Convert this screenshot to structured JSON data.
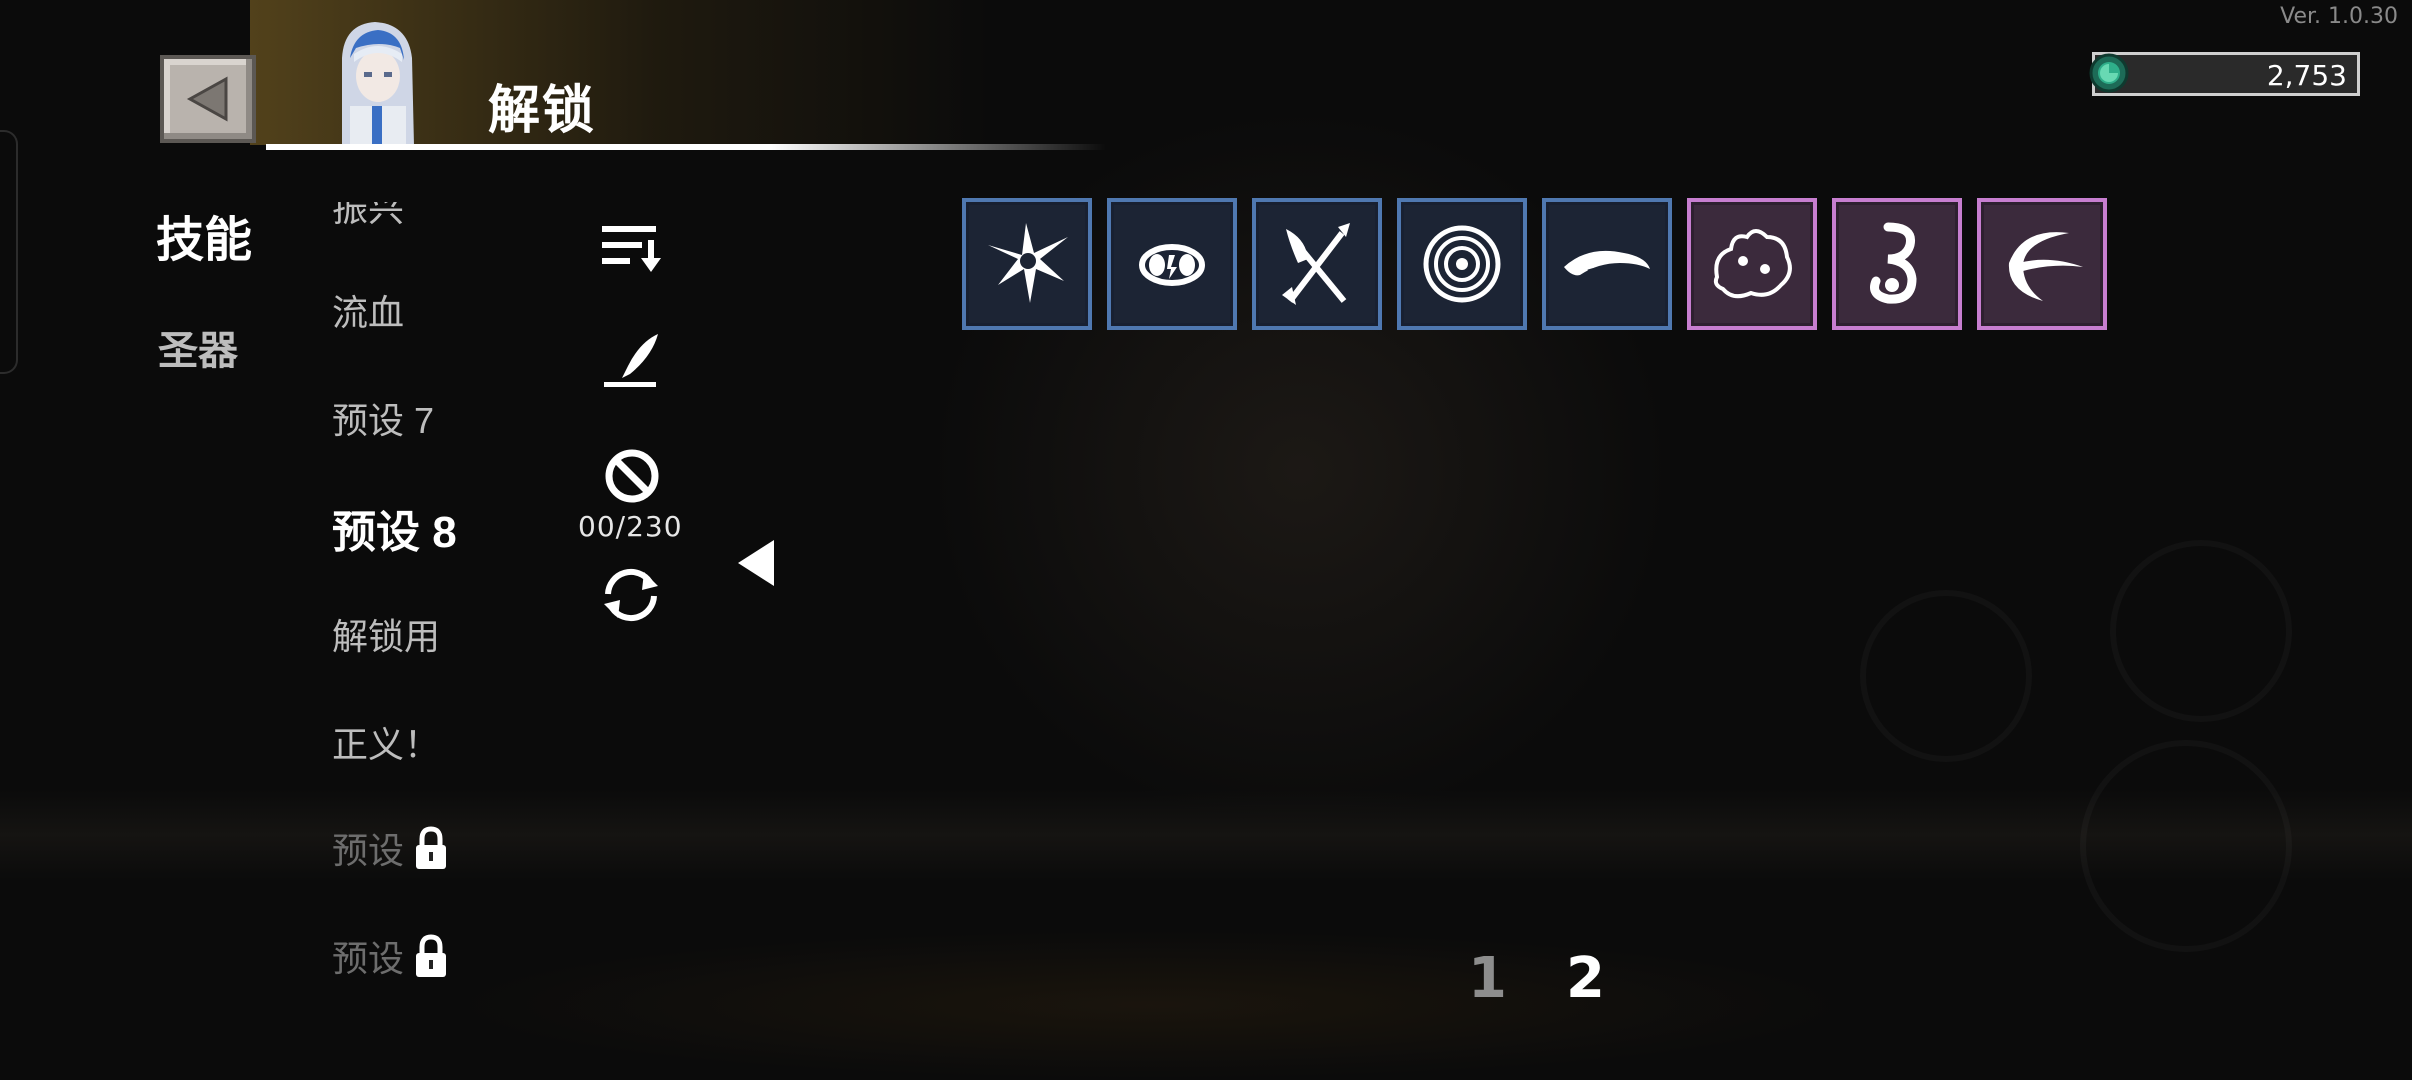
{
  "version": "Ver. 1.0.30",
  "header": {
    "title": "解锁"
  },
  "currency": {
    "value": "2,753",
    "icon": "green-gem-icon",
    "color": "#2fae8a"
  },
  "tabs": [
    {
      "label": "技能",
      "active": true
    },
    {
      "label": "圣器",
      "active": false
    }
  ],
  "presets": [
    {
      "label": "振兴",
      "state": "partial"
    },
    {
      "label": "流血",
      "state": "normal"
    },
    {
      "label": "预设 7",
      "state": "normal"
    },
    {
      "label": "预设 8",
      "state": "active"
    },
    {
      "label": "解锁用",
      "state": "normal"
    },
    {
      "label": "正义！",
      "state": "normal"
    },
    {
      "label": "预设",
      "state": "locked"
    },
    {
      "label": "预设",
      "state": "locked"
    }
  ],
  "tools": {
    "sort_icon": "sort-icon",
    "rename_icon": "quill-icon",
    "clear_icon": "no-sign-icon",
    "counter": "00/230",
    "reset_icon": "refresh-icon"
  },
  "skills": [
    {
      "icon": "thorn-burst-skill-icon",
      "rarity": "blue"
    },
    {
      "icon": "claw-orb-skill-icon",
      "rarity": "blue"
    },
    {
      "icon": "crossed-blades-skill-icon",
      "rarity": "blue"
    },
    {
      "icon": "vortex-skill-icon",
      "rarity": "blue"
    },
    {
      "icon": "wind-slash-skill-icon",
      "rarity": "blue"
    },
    {
      "icon": "beast-swarm-skill-icon",
      "rarity": "purple"
    },
    {
      "icon": "serpent-skill-icon",
      "rarity": "purple"
    },
    {
      "icon": "crescent-slash-skill-icon",
      "rarity": "purple"
    }
  ],
  "pagination": {
    "pages": [
      "1",
      "2"
    ],
    "current": "2"
  },
  "colors": {
    "blue_frame": "#4f78b0",
    "purple_frame": "#c77ed0",
    "accent_gold": "#8c6e28"
  }
}
